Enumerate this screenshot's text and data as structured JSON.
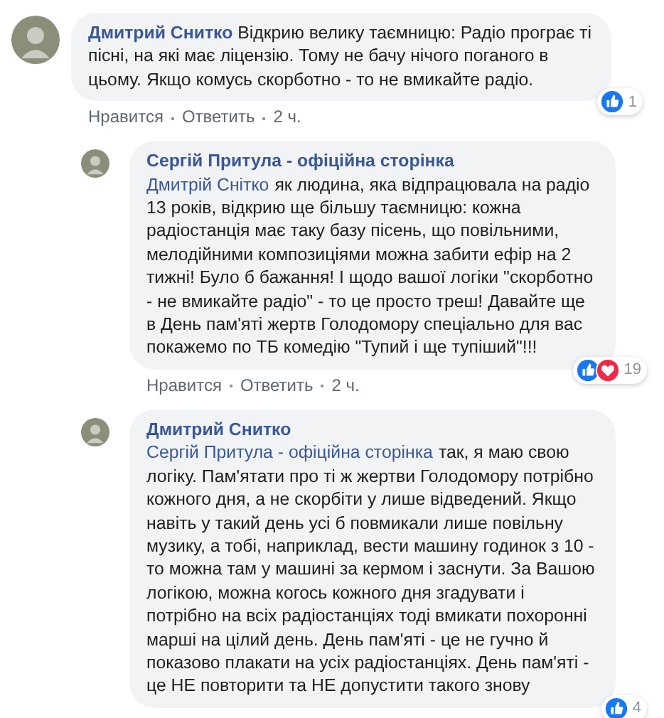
{
  "comments": [
    {
      "author": "Дмитрий Снитко",
      "text": "Відкрию велику таємницю: Радіо програє ті пісні, на які має ліцензію. Тому не бачу нічого поганого в цьому. Якщо комусь скорботно - то не вмикайте радіо.",
      "reply": false,
      "reactions": [
        {
          "kind": "like"
        }
      ],
      "reaction_count": "1",
      "actions": [
        "Нравится",
        "Ответить"
      ],
      "time": "2 ч."
    },
    {
      "author": "Сергій Притула - офіційна сторінка",
      "mention": "Дмитрій Снітко",
      "text": "як людина, яка відпрацювала на радіо 13 років, відкрию ще більшу таємницю: кожна радіостанція має таку базу пісень, що повільними, мелодійними композиціями можна забити ефір на 2 тижні! Було б бажання! І щодо вашої логіки \"скорботно - не вмикайте радіо\" - то це просто треш! Давайте ще в День пам'яті жертв Голодомору спеціально для вас покажемо по ТБ комедію \"Тупий і ще тупіший\"!!!",
      "reply": true,
      "reactions": [
        {
          "kind": "like"
        },
        {
          "kind": "love"
        }
      ],
      "reaction_count": "19",
      "actions": [
        "Нравится",
        "Ответить"
      ],
      "time": "2 ч."
    },
    {
      "author": "Дмитрий Снитко",
      "mention": "Сергій Притула - офіційна сторінка",
      "text": "так, я маю свою логіку. Пам'ятати про ті ж жертви Голодомору потрібно кожного дня, а не скорбіти у лише відведений. Якщо навіть у такий день усі б повмикали лише повільну музику, а тобі, наприклад, вести машину годинок з 10 - то можна там у машині за кермом і заснути. За Вашою логікою, можна когось кожного дня згадувати і потрібно на всіх радіостанціях тоді вмикати похоронні марші на цілий день. День пам'яті - це не гучно й показово плакати на усіх радіостанціях. День пам'яті - це НЕ повторити та НЕ допустити такого знову",
      "reply": true,
      "reactions": [
        {
          "kind": "like"
        }
      ],
      "reaction_count": "4"
    }
  ]
}
